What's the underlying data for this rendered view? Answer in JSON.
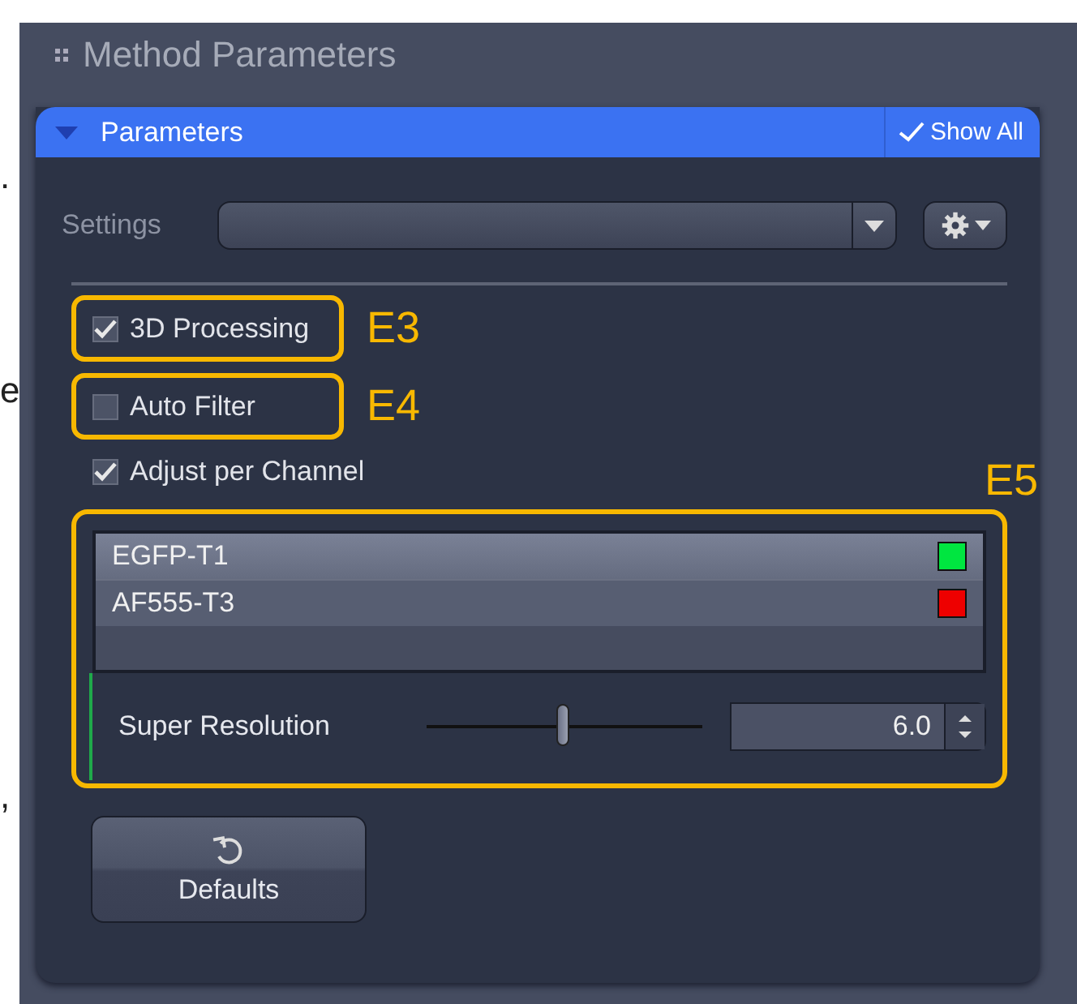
{
  "margin_fragments": [
    ".",
    "e",
    ","
  ],
  "panel": {
    "title": "Method Parameters"
  },
  "section": {
    "title": "Parameters",
    "expanded": true,
    "show_all": {
      "label": "Show All",
      "checked": true
    }
  },
  "settings": {
    "label": "Settings"
  },
  "options": [
    {
      "label": "3D Processing",
      "checked": true,
      "annotation": "E3"
    },
    {
      "label": "Auto Filter",
      "checked": false,
      "annotation": "E4"
    },
    {
      "label": "Adjust per Channel",
      "checked": true
    }
  ],
  "channel_group": {
    "annotation": "E5",
    "channels": [
      {
        "name": "EGFP-T1",
        "color": "#00e640",
        "selected": true
      },
      {
        "name": "AF555-T3",
        "color": "#ee0000",
        "selected": false
      }
    ],
    "slider": {
      "label": "Super Resolution",
      "level": 0.5,
      "value": "6.0"
    }
  },
  "defaults_button": {
    "label": "Defaults"
  }
}
